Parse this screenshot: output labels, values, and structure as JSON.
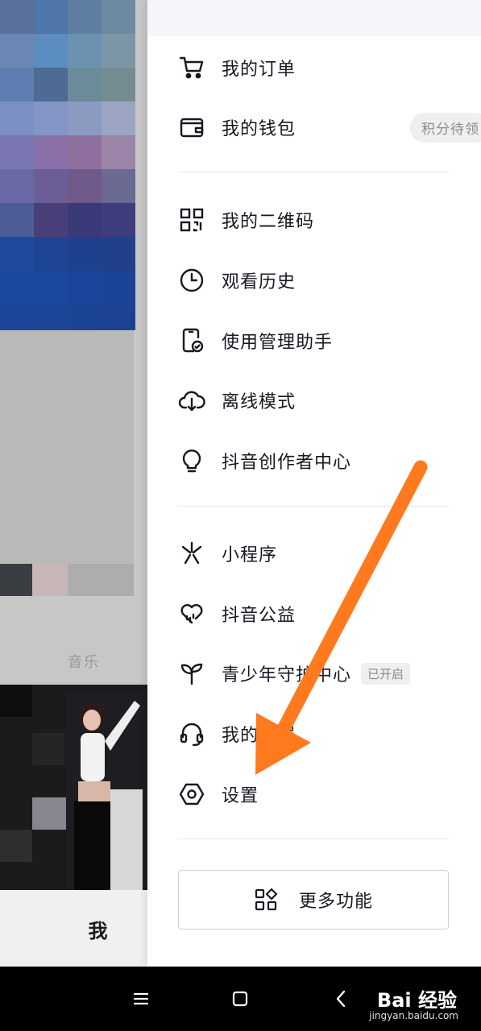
{
  "menu": {
    "orders": "我的订单",
    "wallet": "我的钱包",
    "wallet_badge": "积分待领",
    "qrcode": "我的二维码",
    "history": "观看历史",
    "usage_manager": "使用管理助手",
    "offline": "离线模式",
    "creator_center": "抖音创作者中心",
    "mini_programs": "小程序",
    "charity": "抖音公益",
    "teen_mode": "青少年守护中心",
    "teen_badge": "已开启",
    "customer_service": "我的客服",
    "settings": "设置",
    "more": "更多功能"
  },
  "background": {
    "music_label": "音乐",
    "me_tab": "我"
  },
  "watermark": {
    "brand": "Bai 经验",
    "url": "jingyan.baidu.com"
  },
  "colors": {
    "arrow": "#ff7a1f",
    "drawer_bg": "#ffffff",
    "dim_overlay": "#c7c7c7"
  }
}
